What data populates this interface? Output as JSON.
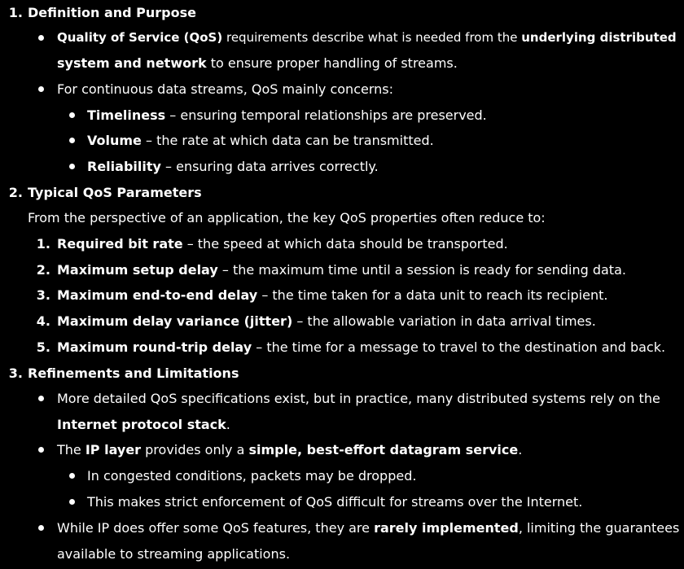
{
  "sections": [
    {
      "number": "1.",
      "title": "Definition and Purpose",
      "bullets": [
        {
          "line1": {
            "b1": "Quality of Service (QoS)",
            "t1": " requirements describe what is needed from the ",
            "b2": "underlying distributed"
          },
          "line2": {
            "b1": "system and network",
            "t1": " to ensure proper handling of streams."
          }
        },
        {
          "text": "For continuous data streams, QoS mainly concerns:",
          "sub": [
            {
              "b": "Timeliness",
              "t": " – ensuring temporal relationships are preserved."
            },
            {
              "b": "Volume",
              "t": " – the rate at which data can be transmitted."
            },
            {
              "b": "Reliability",
              "t": " – ensuring data arrives correctly."
            }
          ]
        }
      ]
    },
    {
      "number": "2.",
      "title": "Typical QoS Parameters",
      "intro": "From the perspective of an application, the key QoS properties often reduce to:",
      "items": [
        {
          "n": "1.",
          "b": "Required bit rate",
          "t": " – the speed at which data should be transported."
        },
        {
          "n": "2.",
          "b": "Maximum setup delay",
          "t": " – the maximum time until a session is ready for sending data."
        },
        {
          "n": "3.",
          "b": "Maximum end-to-end delay",
          "t": " – the time taken for a data unit to reach its recipient."
        },
        {
          "n": "4.",
          "b": "Maximum delay variance (jitter)",
          "t": " – the allowable variation in data arrival times."
        },
        {
          "n": "5.",
          "b": "Maximum round-trip delay",
          "t": " – the time for a message to travel to the destination and back."
        }
      ]
    },
    {
      "number": "3.",
      "title": "Refinements and Limitations",
      "bullets": [
        {
          "line1": {
            "t1": "More detailed QoS specifications exist, but in practice, many distributed systems rely on the"
          },
          "line2": {
            "b1": "Internet protocol stack",
            "t1": "."
          }
        },
        {
          "line1": {
            "t1": "The ",
            "b1": "IP layer",
            "t2": " provides only a ",
            "b2": "simple, best-effort datagram service",
            "t3": "."
          },
          "sub": [
            {
              "t": "In congested conditions, packets may be dropped."
            },
            {
              "t": "This makes strict enforcement of QoS difficult for streams over the Internet."
            }
          ]
        },
        {
          "line1": {
            "t1": "While IP does offer some QoS features, they are ",
            "b1": "rarely implemented",
            "t2": ", limiting the guarantees"
          },
          "line2": {
            "t1": "available to streaming applications."
          }
        }
      ]
    }
  ]
}
